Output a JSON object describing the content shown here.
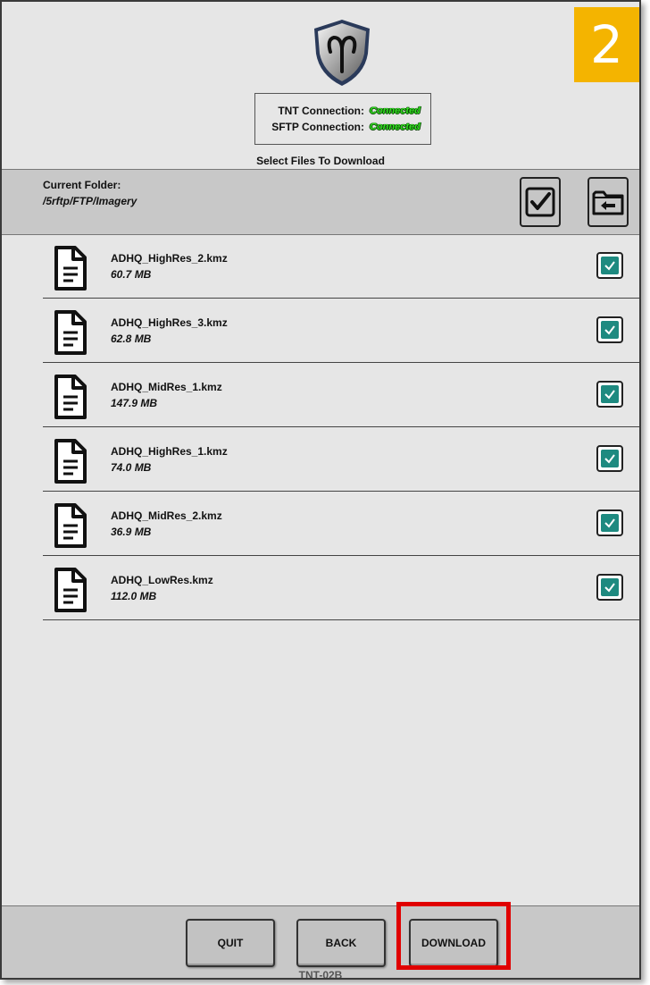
{
  "step_badge": "2",
  "logo": {
    "icon": "aries-shield-icon"
  },
  "connection": {
    "tnt_label": "TNT Connection:",
    "tnt_status": "Connected",
    "sftp_label": "SFTP Connection:",
    "sftp_status": "Connected",
    "status_color": "#33dd22"
  },
  "select_title": "Select Files To Download",
  "folder": {
    "label": "Current Folder:",
    "path": "/5rftp/FTP/Imagery",
    "select_all_icon": "check-square-icon",
    "parent_folder_icon": "folder-back-icon"
  },
  "files": [
    {
      "name": "ADHQ_HighRes_2.kmz",
      "size": "60.7 MB",
      "checked": true
    },
    {
      "name": "ADHQ_HighRes_3.kmz",
      "size": "62.8 MB",
      "checked": true
    },
    {
      "name": "ADHQ_MidRes_1.kmz",
      "size": "147.9 MB",
      "checked": true
    },
    {
      "name": "ADHQ_HighRes_1.kmz",
      "size": "74.0 MB",
      "checked": true
    },
    {
      "name": "ADHQ_MidRes_2.kmz",
      "size": "36.9 MB",
      "checked": true
    },
    {
      "name": "ADHQ_LowRes.kmz",
      "size": "112.0 MB",
      "checked": true
    }
  ],
  "footer": {
    "quit_label": "QUIT",
    "back_label": "BACK",
    "download_label": "DOWNLOAD",
    "device_id": "TNT-02B"
  },
  "colors": {
    "badge": "#f4b400",
    "checkbox": "#1e8a80",
    "highlight": "#e00000"
  }
}
